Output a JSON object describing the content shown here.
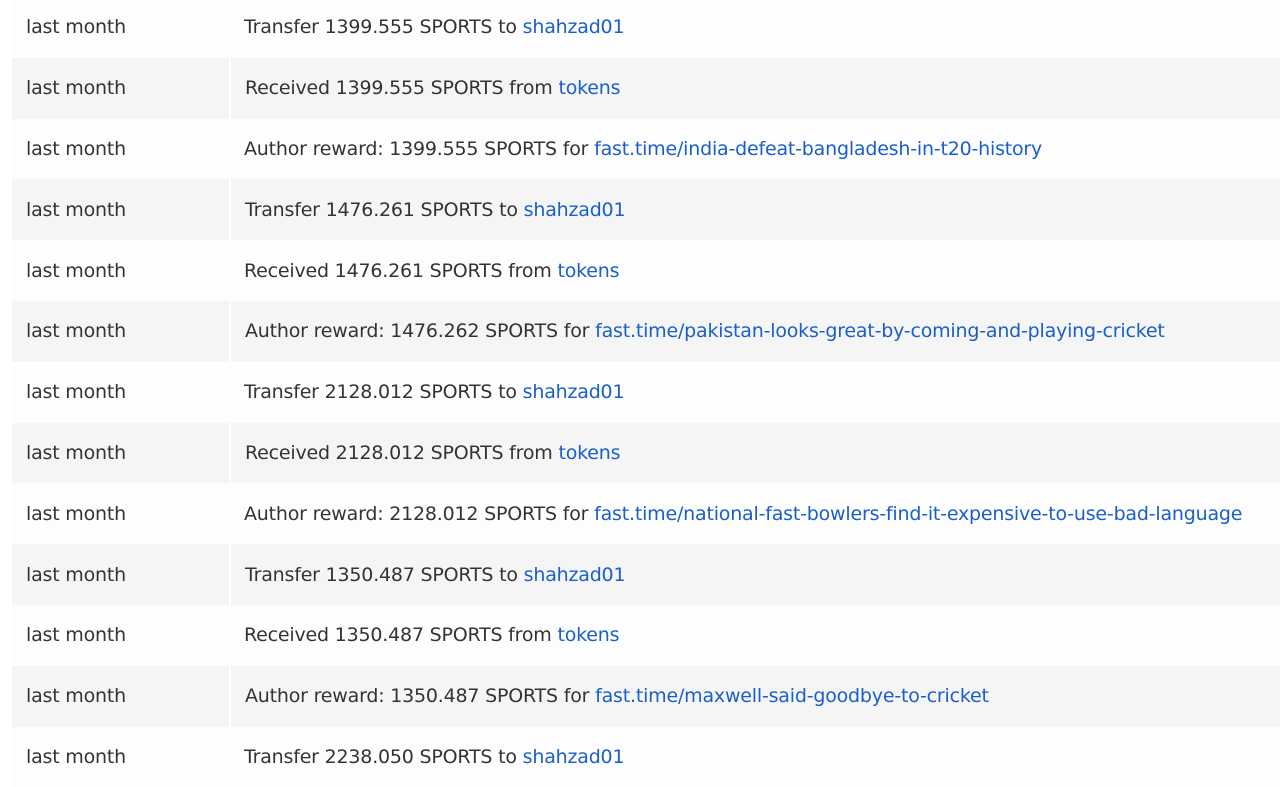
{
  "rows": [
    {
      "time": "last month",
      "prefix": "Transfer 1399.555 SPORTS to ",
      "link": "shahzad01"
    },
    {
      "time": "last month",
      "prefix": "Received 1399.555 SPORTS from ",
      "link": "tokens"
    },
    {
      "time": "last month",
      "prefix": "Author reward: 1399.555 SPORTS for ",
      "link": "fast.time/india-defeat-bangladesh-in-t20-history"
    },
    {
      "time": "last month",
      "prefix": "Transfer 1476.261 SPORTS to ",
      "link": "shahzad01"
    },
    {
      "time": "last month",
      "prefix": "Received 1476.261 SPORTS from ",
      "link": "tokens"
    },
    {
      "time": "last month",
      "prefix": "Author reward: 1476.262 SPORTS for ",
      "link": "fast.time/pakistan-looks-great-by-coming-and-playing-cricket"
    },
    {
      "time": "last month",
      "prefix": "Transfer 2128.012 SPORTS to ",
      "link": "shahzad01"
    },
    {
      "time": "last month",
      "prefix": "Received 2128.012 SPORTS from ",
      "link": "tokens"
    },
    {
      "time": "last month",
      "prefix": "Author reward: 2128.012 SPORTS for ",
      "link": "fast.time/national-fast-bowlers-find-it-expensive-to-use-bad-language"
    },
    {
      "time": "last month",
      "prefix": "Transfer 1350.487 SPORTS to ",
      "link": "shahzad01"
    },
    {
      "time": "last month",
      "prefix": "Received 1350.487 SPORTS from ",
      "link": "tokens"
    },
    {
      "time": "last month",
      "prefix": "Author reward: 1350.487 SPORTS for ",
      "link": "fast.time/maxwell-said-goodbye-to-cricket"
    },
    {
      "time": "last month",
      "prefix": "Transfer 2238.050 SPORTS to ",
      "link": "shahzad01"
    }
  ]
}
